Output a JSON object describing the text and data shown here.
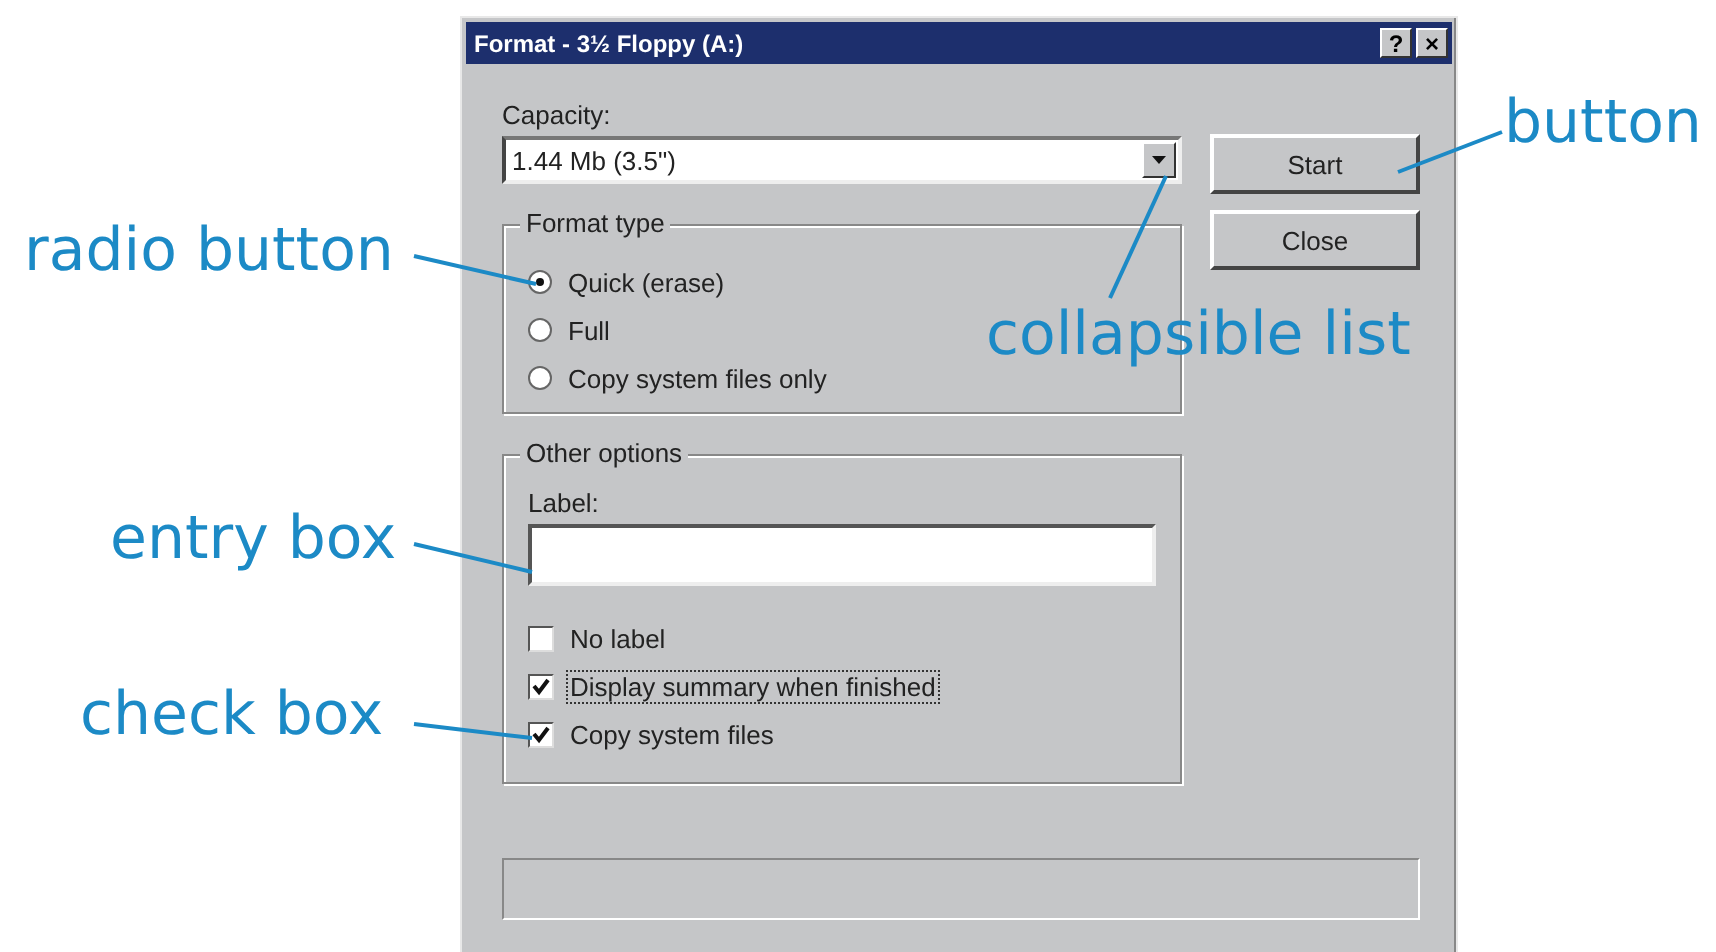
{
  "window": {
    "title": "Format - 3½ Floppy (A:)",
    "title_buttons": [
      "?",
      "×"
    ]
  },
  "capacity": {
    "label": "Capacity:",
    "value": "1.44 Mb (3.5\")"
  },
  "buttons": [
    {
      "label": "Start"
    },
    {
      "label": "Close"
    }
  ],
  "format_type": {
    "title": "Format type",
    "options": [
      {
        "label": "Quick (erase)",
        "selected": true
      },
      {
        "label": "Full",
        "selected": false
      },
      {
        "label": "Copy system files only",
        "selected": false
      }
    ]
  },
  "other_options": {
    "title": "Other options",
    "label_field": {
      "label": "Label:"
    },
    "checkboxes": [
      {
        "label": "No label",
        "checked": false,
        "focused": false
      },
      {
        "label": "Display summary when finished",
        "checked": true,
        "focused": true
      },
      {
        "label": "Copy system files",
        "checked": true,
        "focused": false
      }
    ]
  },
  "annotations": [
    {
      "text": "button"
    },
    {
      "text": "radio button"
    },
    {
      "text": "collapsible list"
    },
    {
      "text": "entry box"
    },
    {
      "text": "check box"
    }
  ]
}
